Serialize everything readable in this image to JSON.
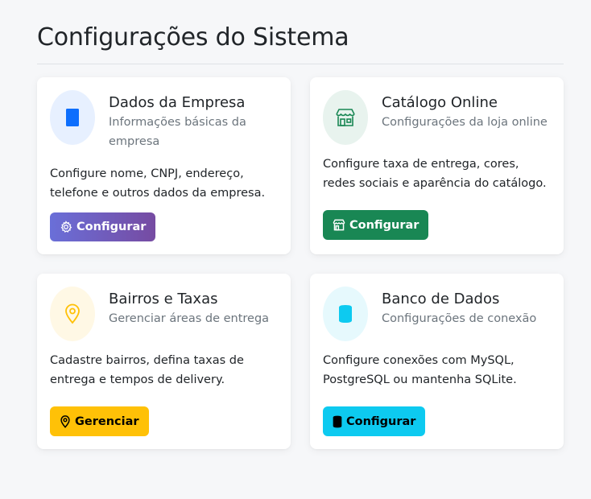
{
  "page": {
    "title": "Configurações do Sistema"
  },
  "cards": [
    {
      "title": "Dados da Empresa",
      "subtitle": "Informações básicas da empresa",
      "description": "Configure nome, CNPJ, endereço, telefone e outros dados da empresa.",
      "button_label": "Configurar",
      "icon": "building-icon",
      "icon_color": "#0d6efd",
      "icon_bg": "#e7f0ff",
      "button_icon": "gear-icon"
    },
    {
      "title": "Catálogo Online",
      "subtitle": "Configurações da loja online",
      "description": "Configure taxa de entrega, cores, redes sociais e aparência do catálogo.",
      "button_label": "Configurar",
      "icon": "shop-icon",
      "icon_color": "#198754",
      "icon_bg": "#e8f3ee",
      "button_icon": "shop-icon"
    },
    {
      "title": "Bairros e Taxas",
      "subtitle": "Gerenciar áreas de entrega",
      "description": "Cadastre bairros, defina taxas de entrega e tempos de delivery.",
      "button_label": "Gerenciar",
      "icon": "map-pin-icon",
      "icon_color": "#ffc107",
      "icon_bg": "#fff8e5",
      "button_icon": "map-pin-icon"
    },
    {
      "title": "Banco de Dados",
      "subtitle": "Configurações de conexão",
      "description": "Configure conexões com MySQL, PostgreSQL ou mantenha SQLite.",
      "button_label": "Configurar",
      "icon": "database-icon",
      "icon_color": "#0dcaf0",
      "icon_bg": "#e6f9fd",
      "button_icon": "database-icon"
    }
  ]
}
